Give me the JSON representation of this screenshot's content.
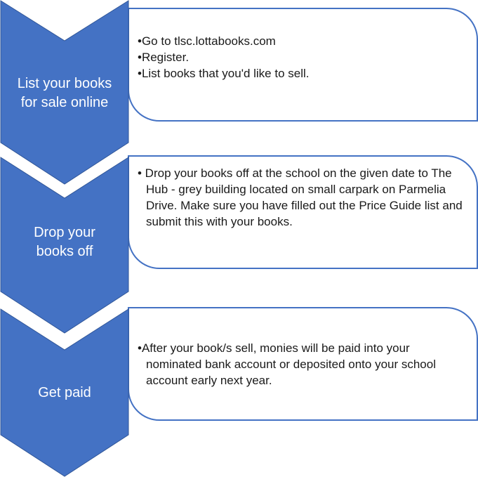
{
  "steps": [
    {
      "label": "List your books\nfor sale online",
      "bullets": [
        "•Go to tlsc.lottabooks.com",
        "•Register.",
        "•List books that you'd like to sell."
      ]
    },
    {
      "label": "Drop your\nbooks off",
      "bullets": [
        "• Drop your books off at the school on the given date to The Hub - grey building located on small carpark on Parmelia Drive. Make sure you have filled out the Price Guide list and submit this with your books."
      ]
    },
    {
      "label": "Get paid",
      "bullets": [
        "•After your book/s sell, monies will be paid into your nominated bank account or deposited onto your school account early next year."
      ]
    }
  ],
  "colors": {
    "chevron_fill": "#4472C4",
    "chevron_stroke": "#2F5597",
    "card_stroke": "#4472C4",
    "card_fill": "#FFFFFF",
    "label_text": "#FFFFFF",
    "body_text": "#1A1A1A"
  }
}
